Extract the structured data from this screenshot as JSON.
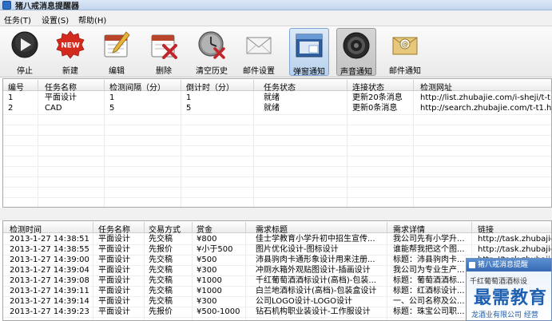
{
  "window": {
    "title": "猪八戒消息提醒器"
  },
  "menu": [
    {
      "label": "任务(T)"
    },
    {
      "label": "设置(S)"
    },
    {
      "label": "帮助(H)"
    }
  ],
  "toolbar": [
    {
      "label": "停止",
      "icon": "stop-icon"
    },
    {
      "label": "新建",
      "icon": "new-icon"
    },
    {
      "label": "编辑",
      "icon": "edit-icon"
    },
    {
      "label": "删除",
      "icon": "delete-icon"
    },
    {
      "label": "清空历史",
      "icon": "clock-icon"
    },
    {
      "label": "邮件设置",
      "icon": "mail-settings-icon"
    },
    {
      "label": "弹窗通知",
      "icon": "popup-icon",
      "state": "active"
    },
    {
      "label": "声音通知",
      "icon": "speaker-icon",
      "state": "pressed"
    },
    {
      "label": "邮件通知",
      "icon": "mail-at-icon"
    }
  ],
  "tasks": {
    "columns": [
      "编号",
      "任务名称",
      "检测间隔（分）",
      "倒计时（分）",
      "任务状态",
      "连接状态",
      "检测网址"
    ],
    "rows": [
      [
        "1",
        "平面设计",
        "1",
        "1",
        "就绪",
        "更新20条消息",
        "http://list.zhubajie.com/i-sheji/t-t1.ht"
      ],
      [
        "2",
        "CAD",
        "5",
        "5",
        "就绪",
        "更新0条消息",
        "http://search.zhubajie.com/t-t1.htm"
      ]
    ]
  },
  "log": {
    "columns": [
      "检测时间",
      "任务名称",
      "交易方式",
      "赏金",
      "需求标题",
      "需求详情",
      "链接"
    ],
    "rows": [
      [
        "2013-1-27  14:38:51",
        "平面设计",
        "先交稿",
        "¥800",
        "佳士学教育小学升初中招生宣传...",
        "我公司先有小学升...",
        "http://task.zhubajie..."
      ],
      [
        "2013-1-27  14:38:55",
        "平面设计",
        "先报价",
        "¥小于500",
        "图片优化设计-图标设计",
        "谁能帮我把这个图...",
        "http://task.zhubajie..."
      ],
      [
        "2013-1-27  14:39:00",
        "平面设计",
        "先交稿",
        "¥500",
        "沛县驹肉卡通形象设计用来注册...",
        "标题：沛县驹肉卡...",
        "http://task.zhubajie..."
      ],
      [
        "2013-1-27  14:39:04",
        "平面设计",
        "先交稿",
        "¥300",
        "冲厕水箱外观贴图设计-插画设计",
        "我公司为专业生产...",
        ""
      ],
      [
        "2013-1-27  14:39:08",
        "平面设计",
        "先交稿",
        "¥1000",
        "千红葡萄酒酒标设计(高档)-包装...",
        "标题：葡萄酒酒标...",
        ""
      ],
      [
        "2013-1-27  14:39:11",
        "平面设计",
        "先交稿",
        "¥1000",
        "白兰地酒标设计(高档)-包装盒设计",
        "标题：红酒标设计...",
        ""
      ],
      [
        "2013-1-27  14:39:14",
        "平面设计",
        "先交稿",
        "¥300",
        "公司LOGO设计-LOGO设计",
        "一、公司名称及公...",
        ""
      ],
      [
        "2013-1-27  14:39:23",
        "平面设计",
        "先报价",
        "¥500-1000",
        "钻石机构职业装设计-工作服设计",
        "标题：珠宝公司职...",
        ""
      ]
    ]
  },
  "popup": {
    "title": "猪八戒消息提醒",
    "body": "千红葡萄酒酒标设"
  },
  "watermark": {
    "main": "最需教育",
    "sub": "龙酒业有限公司 经营"
  },
  "colors": {
    "accent": "#3469b3",
    "stop": "#1c1c1c",
    "new": "#d42a1d",
    "delete": "#c0262b"
  }
}
